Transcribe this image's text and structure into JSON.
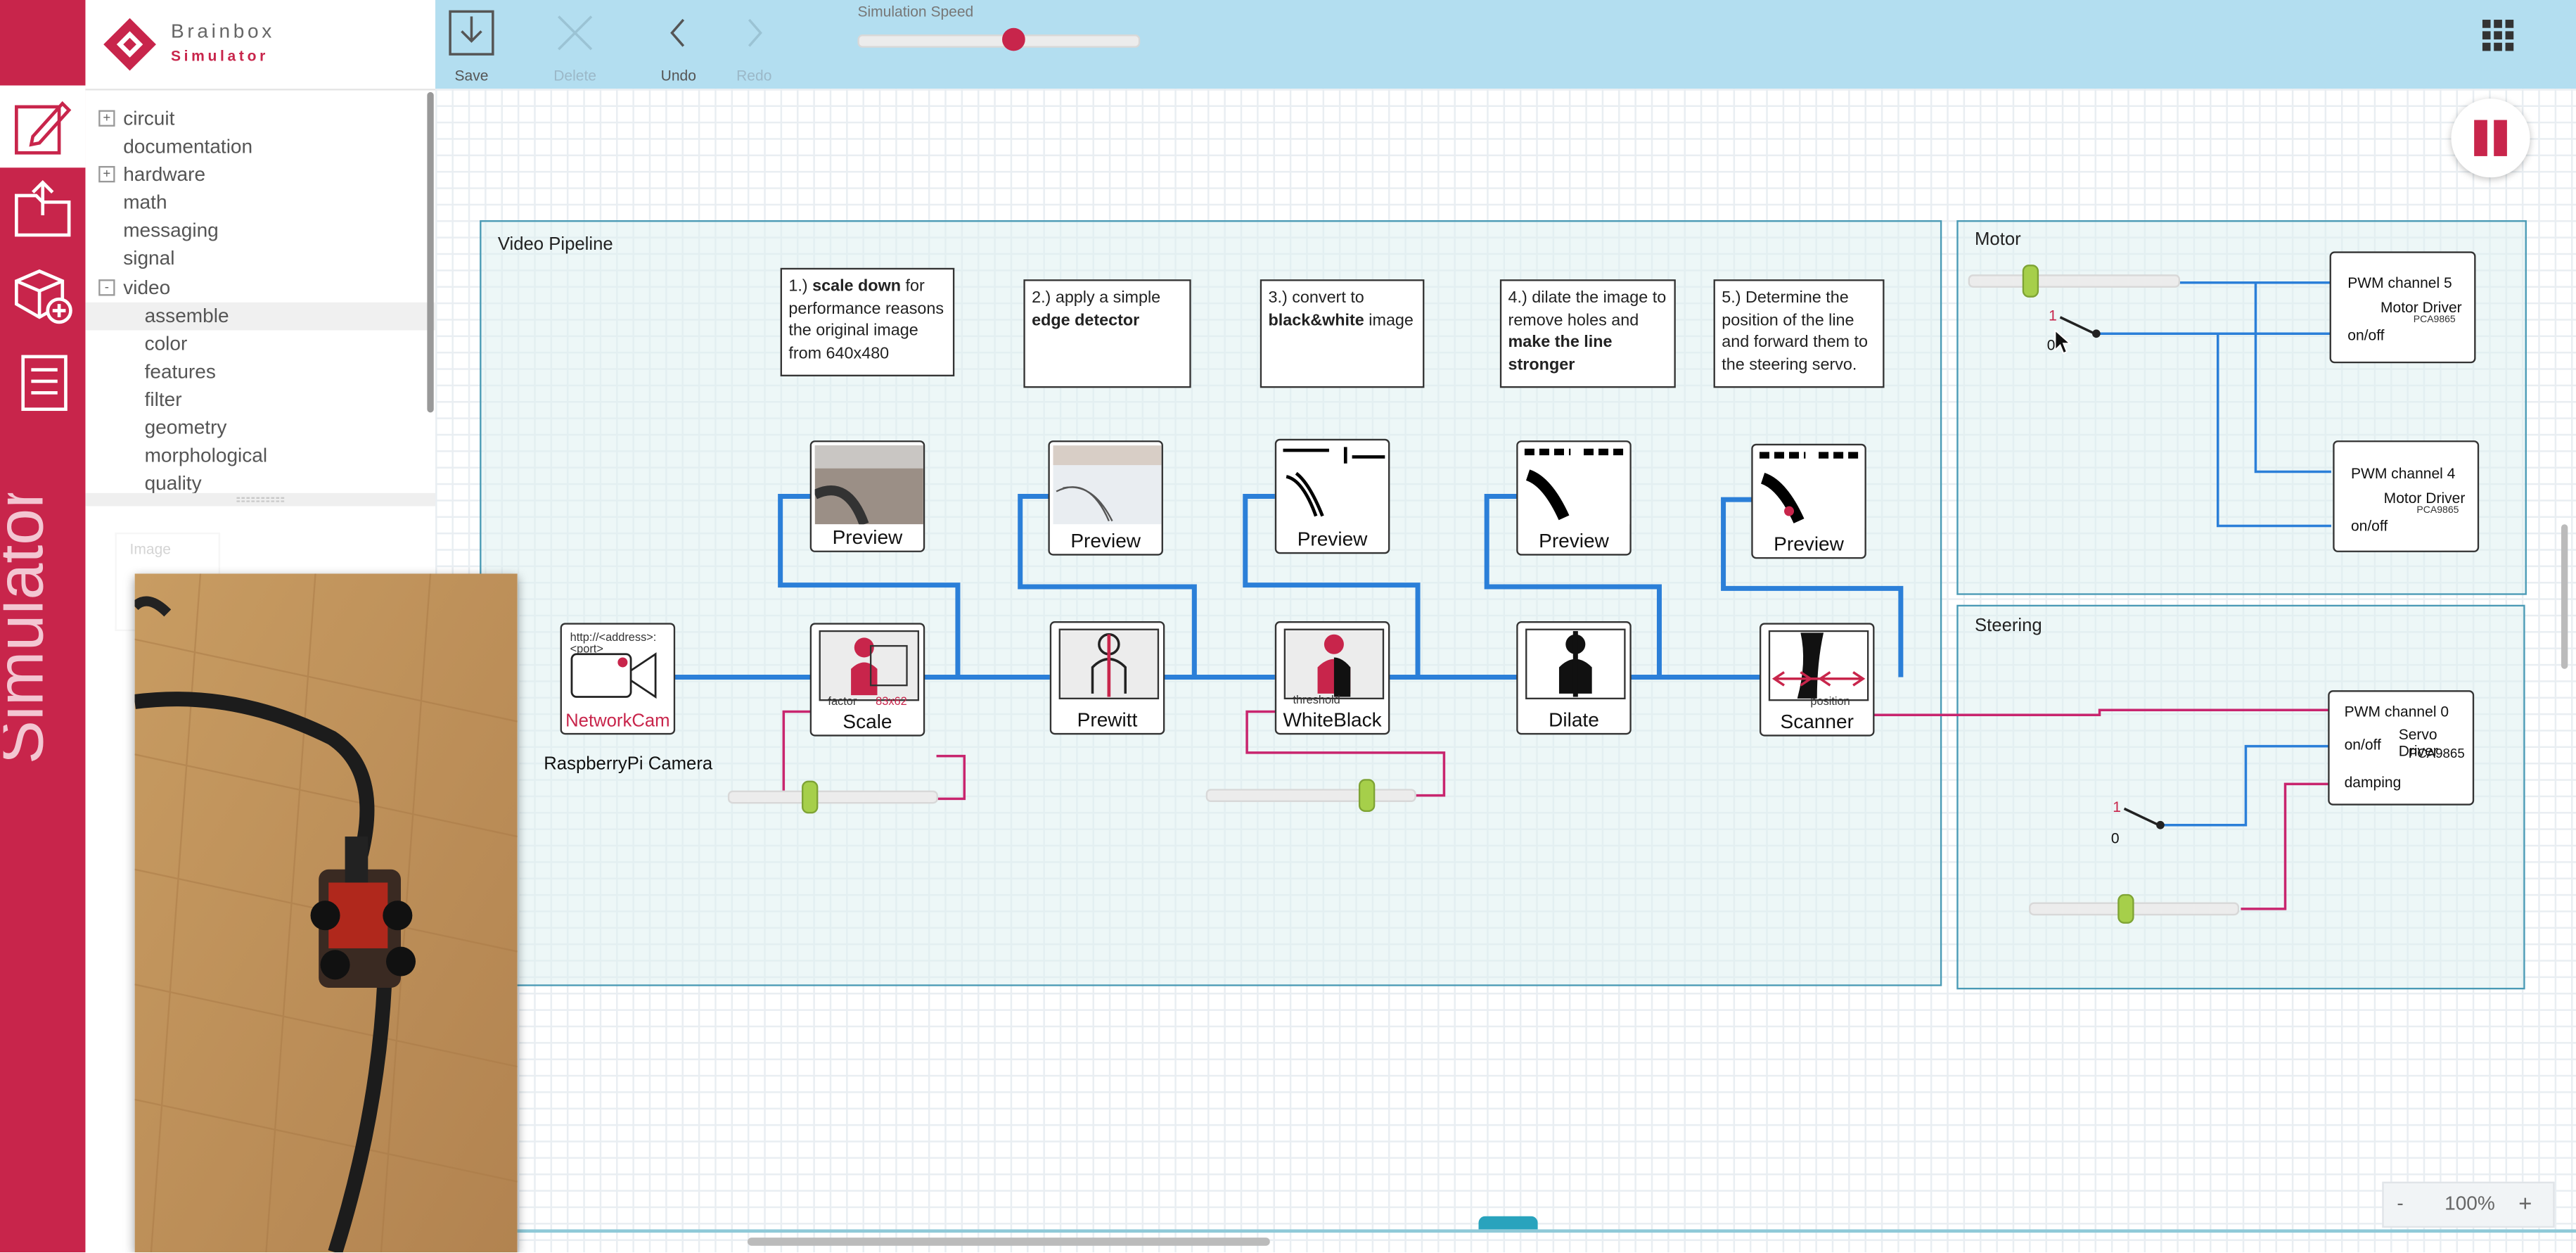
{
  "brand": {
    "name": "Brainbox",
    "subtitle": "Simulator"
  },
  "rail": {
    "title": "Simulator",
    "items": [
      "pencil-edit",
      "folder-open",
      "add-cube",
      "list"
    ]
  },
  "tree": {
    "items": [
      {
        "label": "circuit",
        "toggle": "+"
      },
      {
        "label": "documentation",
        "toggle": ""
      },
      {
        "label": "hardware",
        "toggle": "+"
      },
      {
        "label": "math",
        "toggle": ""
      },
      {
        "label": "messaging",
        "toggle": ""
      },
      {
        "label": "signal",
        "toggle": ""
      },
      {
        "label": "video",
        "toggle": "-"
      },
      {
        "label": "assemble",
        "toggle": "",
        "child": true,
        "selected": true
      },
      {
        "label": "color",
        "toggle": "",
        "child": true
      },
      {
        "label": "features",
        "toggle": "",
        "child": true
      },
      {
        "label": "filter",
        "toggle": "",
        "child": true
      },
      {
        "label": "geometry",
        "toggle": "",
        "child": true
      },
      {
        "label": "morphological",
        "toggle": "",
        "child": true
      },
      {
        "label": "quality",
        "toggle": "",
        "child": true
      }
    ],
    "ghost_label": "Image"
  },
  "toolbar": {
    "save": "Save",
    "delete": "Delete",
    "undo": "Undo",
    "redo": "Redo",
    "speed_label": "Simulation Speed",
    "speed_value": 0.55
  },
  "canvas": {
    "video_pipeline": {
      "title": "Video Pipeline",
      "notes": [
        {
          "pre": "1.) ",
          "bold": "scale down",
          "post": " for performance reasons the original image from 640x480"
        },
        {
          "pre": "2.) apply a simple ",
          "bold": "edge detector",
          "post": ""
        },
        {
          "pre": "3.) convert to ",
          "bold": "black&white",
          "post": " image"
        },
        {
          "pre": "4.) dilate the image to remove holes and ",
          "bold": "make the line stronger",
          "post": ""
        },
        {
          "pre": "5.) Determine the position of the line and forward them to the steering servo.",
          "bold": "",
          "post": ""
        }
      ],
      "preview_label": "Preview",
      "network_cam": {
        "label": "NetworkCam",
        "address": "http://<address>:<port>",
        "caption": "RaspberryPi Camera"
      },
      "scale": {
        "label": "Scale",
        "port": "factor",
        "size": "83x62",
        "slider_value": 0.38
      },
      "prewitt": {
        "label": "Prewitt"
      },
      "whiteblack": {
        "label": "WhiteBlack",
        "port": "threshold",
        "slider_value": 0.76
      },
      "dilate": {
        "label": "Dilate"
      },
      "scanner": {
        "label": "Scanner",
        "port": "position"
      }
    },
    "motor": {
      "title": "Motor",
      "slider_value": 0.28,
      "switch_high": "1",
      "switch_low": "0",
      "driver5": {
        "channel": "PWM channel 5",
        "name": "Motor Driver",
        "chip": "PCA9865",
        "onoff": "on/off"
      },
      "driver4": {
        "channel": "PWM channel 4",
        "name": "Motor Driver",
        "chip": "PCA9865",
        "onoff": "on/off"
      }
    },
    "steering": {
      "title": "Steering",
      "slider_value": 0.45,
      "switch_high": "1",
      "switch_low": "0",
      "servo": {
        "channel": "PWM channel 0",
        "name": "Servo Driver",
        "chip": "PCA9865",
        "onoff": "on/off",
        "damping": "damping"
      }
    },
    "zoom": {
      "minus": "-",
      "level": "100%",
      "plus": "+"
    }
  },
  "colors": {
    "brand": "#c8254b",
    "wire": "#2b7fd8",
    "wire_pink": "#c8256e",
    "toolbar": "#b3def0"
  }
}
